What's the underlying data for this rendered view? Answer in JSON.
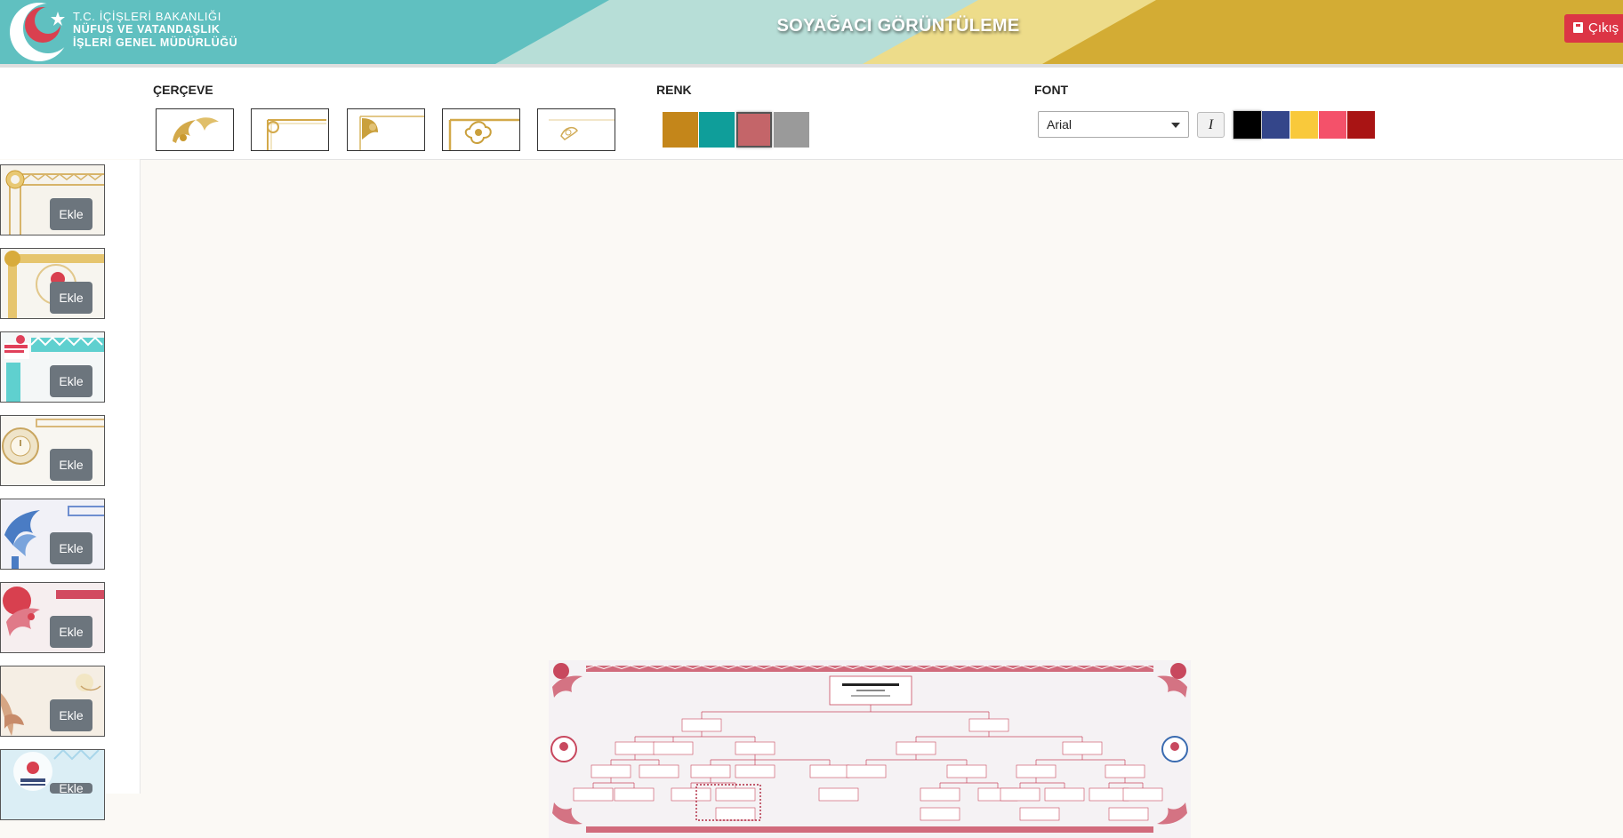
{
  "header": {
    "org_line1": "T.C. İÇİŞLERİ BAKANLIĞI",
    "org_line2": "NÜFUS VE VATANDAŞLIK",
    "org_line3": "İŞLERİ GENEL MÜDÜRLÜĞÜ",
    "title": "SOYAĞACI GÖRÜNTÜLEME",
    "logout_label": "Çıkış"
  },
  "toolbar": {
    "frame_label": "ÇERÇEVE",
    "color_label": "RENK",
    "font_label": "FONT",
    "frame_options": 5,
    "colors": [
      "#c4861a",
      "#0f9e9a",
      "#c46569",
      "#9a9a9a"
    ],
    "selected_color": "#c46569",
    "font_value": "Arial",
    "italic_label": "I",
    "font_colors": [
      "#000000",
      "#34468a",
      "#f9c93b",
      "#f4516a",
      "#a91414"
    ],
    "selected_font_color": "#000000"
  },
  "sidebar": {
    "add_label": "Ekle",
    "templates": [
      "gold-ornament",
      "gold-seal",
      "teal-nvi",
      "gold-clock",
      "blue-floral",
      "red-floral",
      "beige-floral",
      "light-blue-nvi"
    ]
  },
  "preview": {
    "accent": "#c8485e"
  }
}
